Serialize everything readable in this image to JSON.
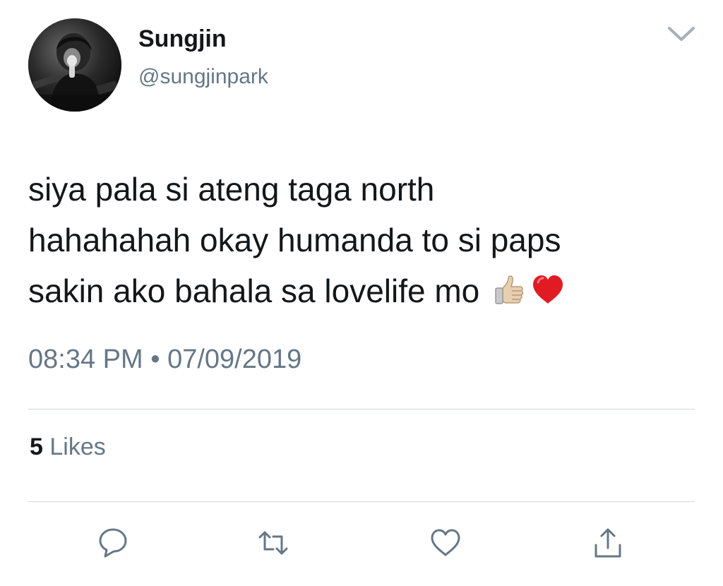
{
  "user": {
    "display_name": "Sungjin",
    "handle": "@sungjinpark",
    "avatar_icon": "profile-photo"
  },
  "header": {
    "menu_icon": "chevron-down-icon"
  },
  "tweet": {
    "lines": [
      "siya pala si ateng taga north",
      "hahahahah okay humanda to si paps",
      "sakin ako bahala sa lovelife mo"
    ],
    "emojis": [
      "thumbs-up-light-skin-emoji",
      "red-heart-emoji"
    ],
    "time": "08:34 PM",
    "separator": "•",
    "date": "07/09/2019"
  },
  "stats": {
    "likes_count": "5",
    "likes_label": "Likes"
  },
  "actions": [
    {
      "name": "reply",
      "icon": "speech-bubble-icon"
    },
    {
      "name": "retweet",
      "icon": "retweet-icon"
    },
    {
      "name": "like",
      "icon": "heart-icon"
    },
    {
      "name": "share",
      "icon": "share-icon"
    }
  ],
  "colors": {
    "text_primary": "#14171a",
    "text_secondary": "#657786",
    "divider": "#d4d9de",
    "icon": "#657786"
  }
}
